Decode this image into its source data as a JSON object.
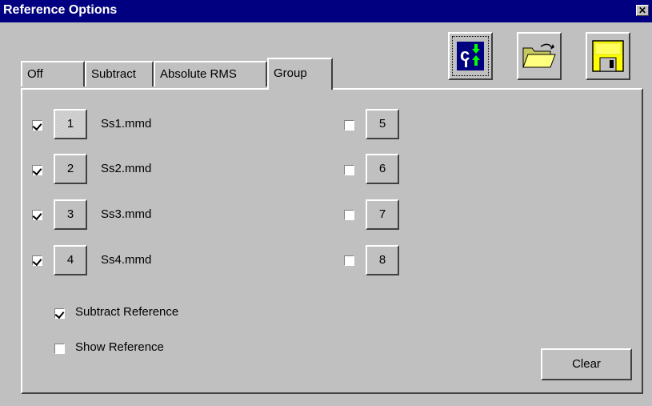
{
  "window": {
    "title": "Reference Options",
    "close_glyph": "✕"
  },
  "toolbar": {
    "buttons": [
      {
        "icon": "reference-swap-icon"
      },
      {
        "icon": "open-folder-icon"
      },
      {
        "icon": "save-disk-icon"
      }
    ]
  },
  "tabs": [
    {
      "label": "Off",
      "active": false
    },
    {
      "label": "Subtract",
      "active": false
    },
    {
      "label": "Absolute RMS",
      "active": false
    },
    {
      "label": "Group",
      "active": true
    }
  ],
  "group": {
    "slots": [
      {
        "number": "1",
        "checked": true,
        "file": "Ss1.mmd",
        "pressed": true
      },
      {
        "number": "2",
        "checked": true,
        "file": "Ss2.mmd",
        "pressed": false
      },
      {
        "number": "3",
        "checked": true,
        "file": "Ss3.mmd",
        "pressed": false
      },
      {
        "number": "4",
        "checked": true,
        "file": "Ss4.mmd",
        "pressed": false
      },
      {
        "number": "5",
        "checked": false,
        "file": "",
        "pressed": false
      },
      {
        "number": "6",
        "checked": false,
        "file": "",
        "pressed": false
      },
      {
        "number": "7",
        "checked": false,
        "file": "",
        "pressed": false
      },
      {
        "number": "8",
        "checked": false,
        "file": "",
        "pressed": false
      }
    ],
    "subtract_reference": {
      "label": "Subtract Reference",
      "checked": true
    },
    "show_reference": {
      "label": "Show Reference",
      "checked": false
    },
    "clear_label": "Clear"
  },
  "colors": {
    "titlebar": "#000080",
    "face": "#c0c0c0",
    "folder": "#ffff80",
    "disk": "#ffff00"
  }
}
